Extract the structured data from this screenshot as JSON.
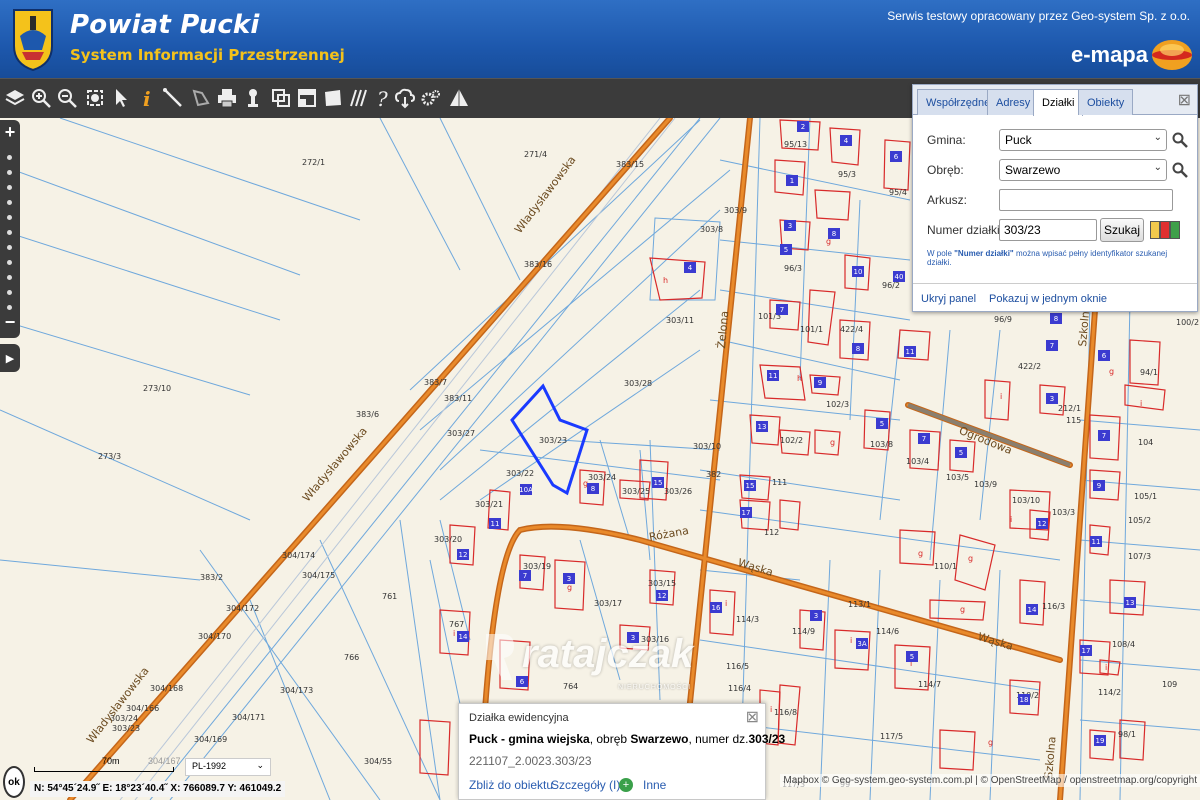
{
  "header": {
    "title": "Powiat Pucki",
    "subtitle": "System Informacji Przestrzennej",
    "service_note": "Serwis testowy opracowany przez Geo-system Sp. z o.o.",
    "emapa": "e-mapa"
  },
  "toolbar": {
    "tools": [
      "layers",
      "zoom-in",
      "zoom-out",
      "zoom-extent",
      "pointer",
      "info",
      "measure-line",
      "measure-area",
      "print",
      "pin",
      "copy",
      "layout",
      "area",
      "hatch",
      "help",
      "download",
      "settings",
      "triangle"
    ]
  },
  "search_panel": {
    "tabs": [
      "Współrzędne",
      "Adresy",
      "Działki",
      "Obiekty"
    ],
    "active_tab": "Działki",
    "gmina_label": "Gmina:",
    "gmina_value": "Puck",
    "obreb_label": "Obręb:",
    "obreb_value": "Swarzewo",
    "arkusz_label": "Arkusz:",
    "arkusz_value": "",
    "numer_label": "Numer działki:",
    "numer_value": "303/23",
    "search_button": "Szukaj",
    "hint_prefix": "W pole ",
    "hint_field": "\"Numer działki\"",
    "hint_suffix": " można wpisać pełny identyfikator szukanej działki.",
    "hide_link": "Ukryj panel",
    "show_link": "Pokazuj w jednym oknie",
    "swatch_colors": [
      "#f2c94c",
      "#e03030",
      "#3fa04a"
    ]
  },
  "popup": {
    "title": "Działka ewidencyjna",
    "desc_bold1": "Puck - gmina wiejska",
    "desc_mid": ", obręb ",
    "desc_bold2": "Swarzewo",
    "desc_mid2": ", numer dz.",
    "desc_bold3": "303/23",
    "identifier": "221107_2.0023.303/23",
    "link_zoom": "Zbliż do obiektu",
    "link_details": "Szczegóły (I)",
    "link_more": "Inne"
  },
  "watermark": {
    "text": "ratajczak",
    "sub": "NIERUCHOMOŚCI"
  },
  "status": {
    "ok": "ok",
    "scale_label": "70m",
    "scale_label2": "304/167",
    "crs": "PL-1992",
    "coords": "N: 54°45´24.9˝  E: 18°23´40.4˝  X: 766089.7  Y: 461049.2",
    "attribution": "Mapbox © Geo-system.geo-system.com.pl | © OpenStreetMap / openstreetmap.org/copyright"
  },
  "map": {
    "streets": [
      "Władysławowska",
      "Władysławowska",
      "Władysławowska",
      "Żelona",
      "Ogrodowa",
      "Różana",
      "Wąska",
      "Wąska",
      "Szkolna",
      "Szkolna"
    ],
    "parcels": [
      "272/1",
      "271/4",
      "383/15",
      "303/9",
      "303/8",
      "383/16",
      "303/11",
      "273/10",
      "383/7",
      "383/11",
      "303/28",
      "383/6",
      "303/27",
      "303/23",
      "303/22",
      "303/24",
      "303/25",
      "303/26",
      "303/10",
      "382",
      "303/21",
      "303/20",
      "303/19",
      "304/174",
      "304/175",
      "761",
      "383/2",
      "304/172",
      "303/17",
      "303/15",
      "303/16",
      "304/170",
      "766",
      "767",
      "764",
      "304/173",
      "304/171",
      "304/169",
      "304/168",
      "304/166",
      "303/24",
      "303/23",
      "304/55",
      "273/3",
      "95/13",
      "95/3",
      "95/4",
      "96/3",
      "96/2",
      "101/3",
      "101/1",
      "422/4",
      "422/2",
      "96/9",
      "102/3",
      "102/2",
      "103/8",
      "103/4",
      "103/5",
      "103/9",
      "103/10",
      "103/3",
      "111",
      "112",
      "110/1",
      "113/1",
      "114/3",
      "114/9",
      "114/6",
      "116/5",
      "116/4",
      "114/7",
      "116/8",
      "117/5",
      "117/3",
      "99",
      "104",
      "105/1",
      "105/2",
      "107/3",
      "108/4",
      "109",
      "114/2",
      "110/2",
      "116/3",
      "98/1",
      "94/1",
      "100/2",
      "212/1",
      "115"
    ]
  }
}
